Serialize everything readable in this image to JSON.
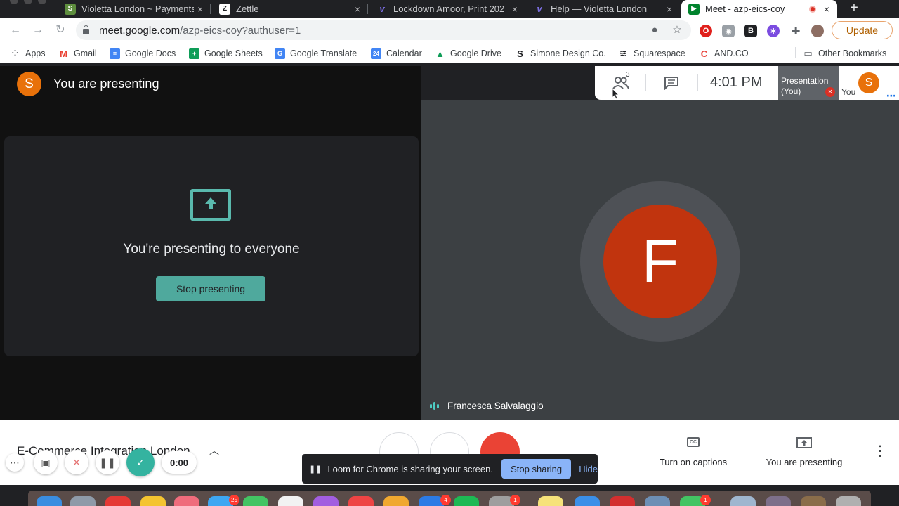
{
  "browser": {
    "tabs": [
      {
        "title": "Violetta London ~ Payments",
        "favicon": "shopify-icon",
        "color": "#5e8e3e"
      },
      {
        "title": "Zettle",
        "favicon": "zettle-icon",
        "color": "#ffffff"
      },
      {
        "title": "Lockdown Amoor, Print 202",
        "favicon": "violetta-icon",
        "color": "#6b5bd6"
      },
      {
        "title": "Help — Violetta London",
        "favicon": "violetta-icon",
        "color": "#6b5bd6"
      },
      {
        "title": "Meet - azp-eics-coy",
        "favicon": "meet-icon",
        "color": "#00832d",
        "active": true
      }
    ],
    "url_host": "meet.google.com",
    "url_path": "/azp-eics-coy?authuser=1",
    "update_label": "Update",
    "bookmarks": [
      {
        "label": "Apps",
        "icon": "apps-grid-icon",
        "color": "#5f6368"
      },
      {
        "label": "Gmail",
        "icon": "gmail-icon",
        "color": "#ea4335"
      },
      {
        "label": "Google Docs",
        "icon": "docs-icon",
        "color": "#4285f4"
      },
      {
        "label": "Google Sheets",
        "icon": "sheets-icon",
        "color": "#0f9d58"
      },
      {
        "label": "Google Translate",
        "icon": "translate-icon",
        "color": "#4285f4"
      },
      {
        "label": "Calendar",
        "icon": "calendar-icon",
        "color": "#4285f4"
      },
      {
        "label": "Google Drive",
        "icon": "drive-icon",
        "color": "#fbbc04"
      },
      {
        "label": "Simone Design Co.",
        "icon": "simone-icon",
        "color": "#202124"
      },
      {
        "label": "Squarespace",
        "icon": "squarespace-icon",
        "color": "#202124"
      },
      {
        "label": "AND.CO",
        "icon": "andco-icon",
        "color": "#e8453c"
      }
    ],
    "other_bookmarks": "Other Bookmarks"
  },
  "meet": {
    "presenting_header": "You are presenting",
    "user_initial": "S",
    "presenting_message": "You're presenting to everyone",
    "stop_presenting_label": "Stop presenting",
    "participant_initial": "F",
    "participant_name": "Francesca Salvalaggio",
    "participant_count": "3",
    "clock": "4:01 PM",
    "self_thumb_label_1": "Presentation",
    "self_thumb_label_2": "(You)",
    "you_label": "You",
    "meeting_title": "E-Commerce Integration London",
    "captions_label": "Turn on captions",
    "presenting_button_label": "You are presenting",
    "cc_text": "CC"
  },
  "loom": {
    "timer": "0:00",
    "banner_message": "Loom for Chrome is sharing your screen.",
    "stop_sharing_label": "Stop sharing",
    "hide_label": "Hide"
  },
  "dock_badges": [
    "25",
    "4",
    "1",
    "1"
  ]
}
